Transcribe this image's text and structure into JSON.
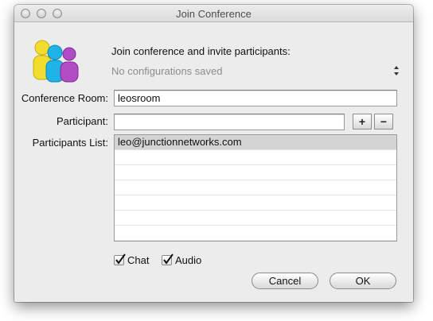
{
  "window": {
    "title": "Join Conference"
  },
  "header": {
    "heading": "Join conference and invite participants:",
    "configurations_placeholder": "No configurations saved"
  },
  "form": {
    "conference_room_label": "Conference Room:",
    "conference_room_value": "leosroom",
    "participant_label": "Participant:",
    "participant_value": "",
    "add_button": "+",
    "remove_button": "−",
    "participants_list_label": "Participants List:",
    "participants": [
      "leo@junctionnetworks.com",
      "",
      "",
      "",
      "",
      "",
      ""
    ]
  },
  "options": {
    "chat_label": "Chat",
    "chat_checked": true,
    "audio_label": "Audio",
    "audio_checked": true
  },
  "buttons": {
    "cancel": "Cancel",
    "ok": "OK"
  },
  "colors": {
    "user_yellow": "#f2dc2e",
    "user_blue": "#1fb3e8",
    "user_purple": "#b24cc4"
  }
}
